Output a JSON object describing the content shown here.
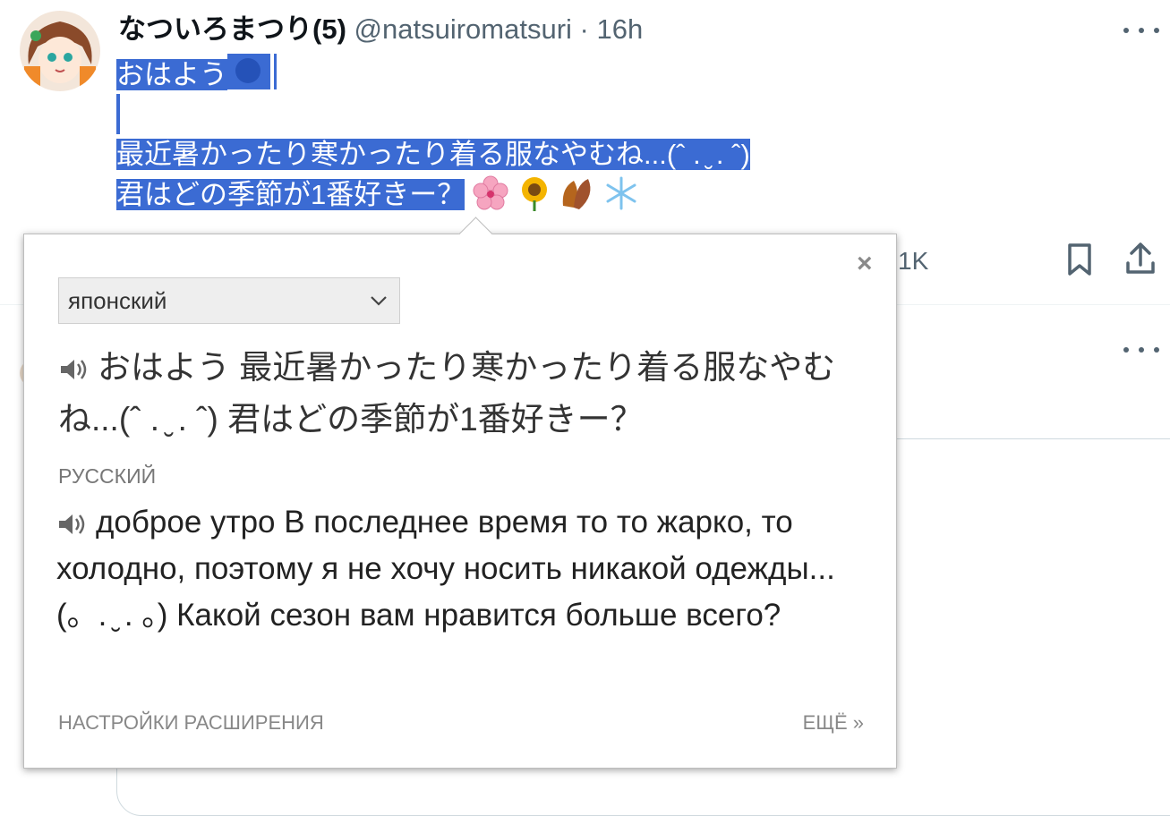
{
  "tweet": {
    "author_name": "なついろまつり(5)",
    "author_handle": "@natsuiromatsuri",
    "separator": "·",
    "time": "16h",
    "lines": {
      "line1": "おはよう",
      "line3": "最近暑かったり寒かったり着る服なやむね...(ˆ . ̮ . ˆ)",
      "line4": "君はどの季節が1番好きー？"
    },
    "emojis": [
      "sun-icon",
      "cherry-blossom-icon",
      "sunflower-icon",
      "fallen-leaf-icon",
      "snowflake-icon"
    ],
    "metric_label": "1K"
  },
  "popup": {
    "close_symbol": "×",
    "source_language": "японский",
    "source_text": "おはよう 最近暑かったり寒かったり着る服なやむね...(ˆ . ̮ . ˆ) 君はどの季節が1番好きー？",
    "target_language": "РУССКИЙ",
    "translation": "доброе утро В последнее время то то жарко, то холодно, поэтому я не хочу носить никакой одежды... (。. ̮ . 。) Какой сезон вам нравится больше всего?",
    "settings_link": "НАСТРОЙКИ РАСШИРЕНИЯ",
    "more_link": "ЕЩЁ »"
  },
  "colors": {
    "selection": "#3b6bd3",
    "secondary_text": "#536471"
  }
}
